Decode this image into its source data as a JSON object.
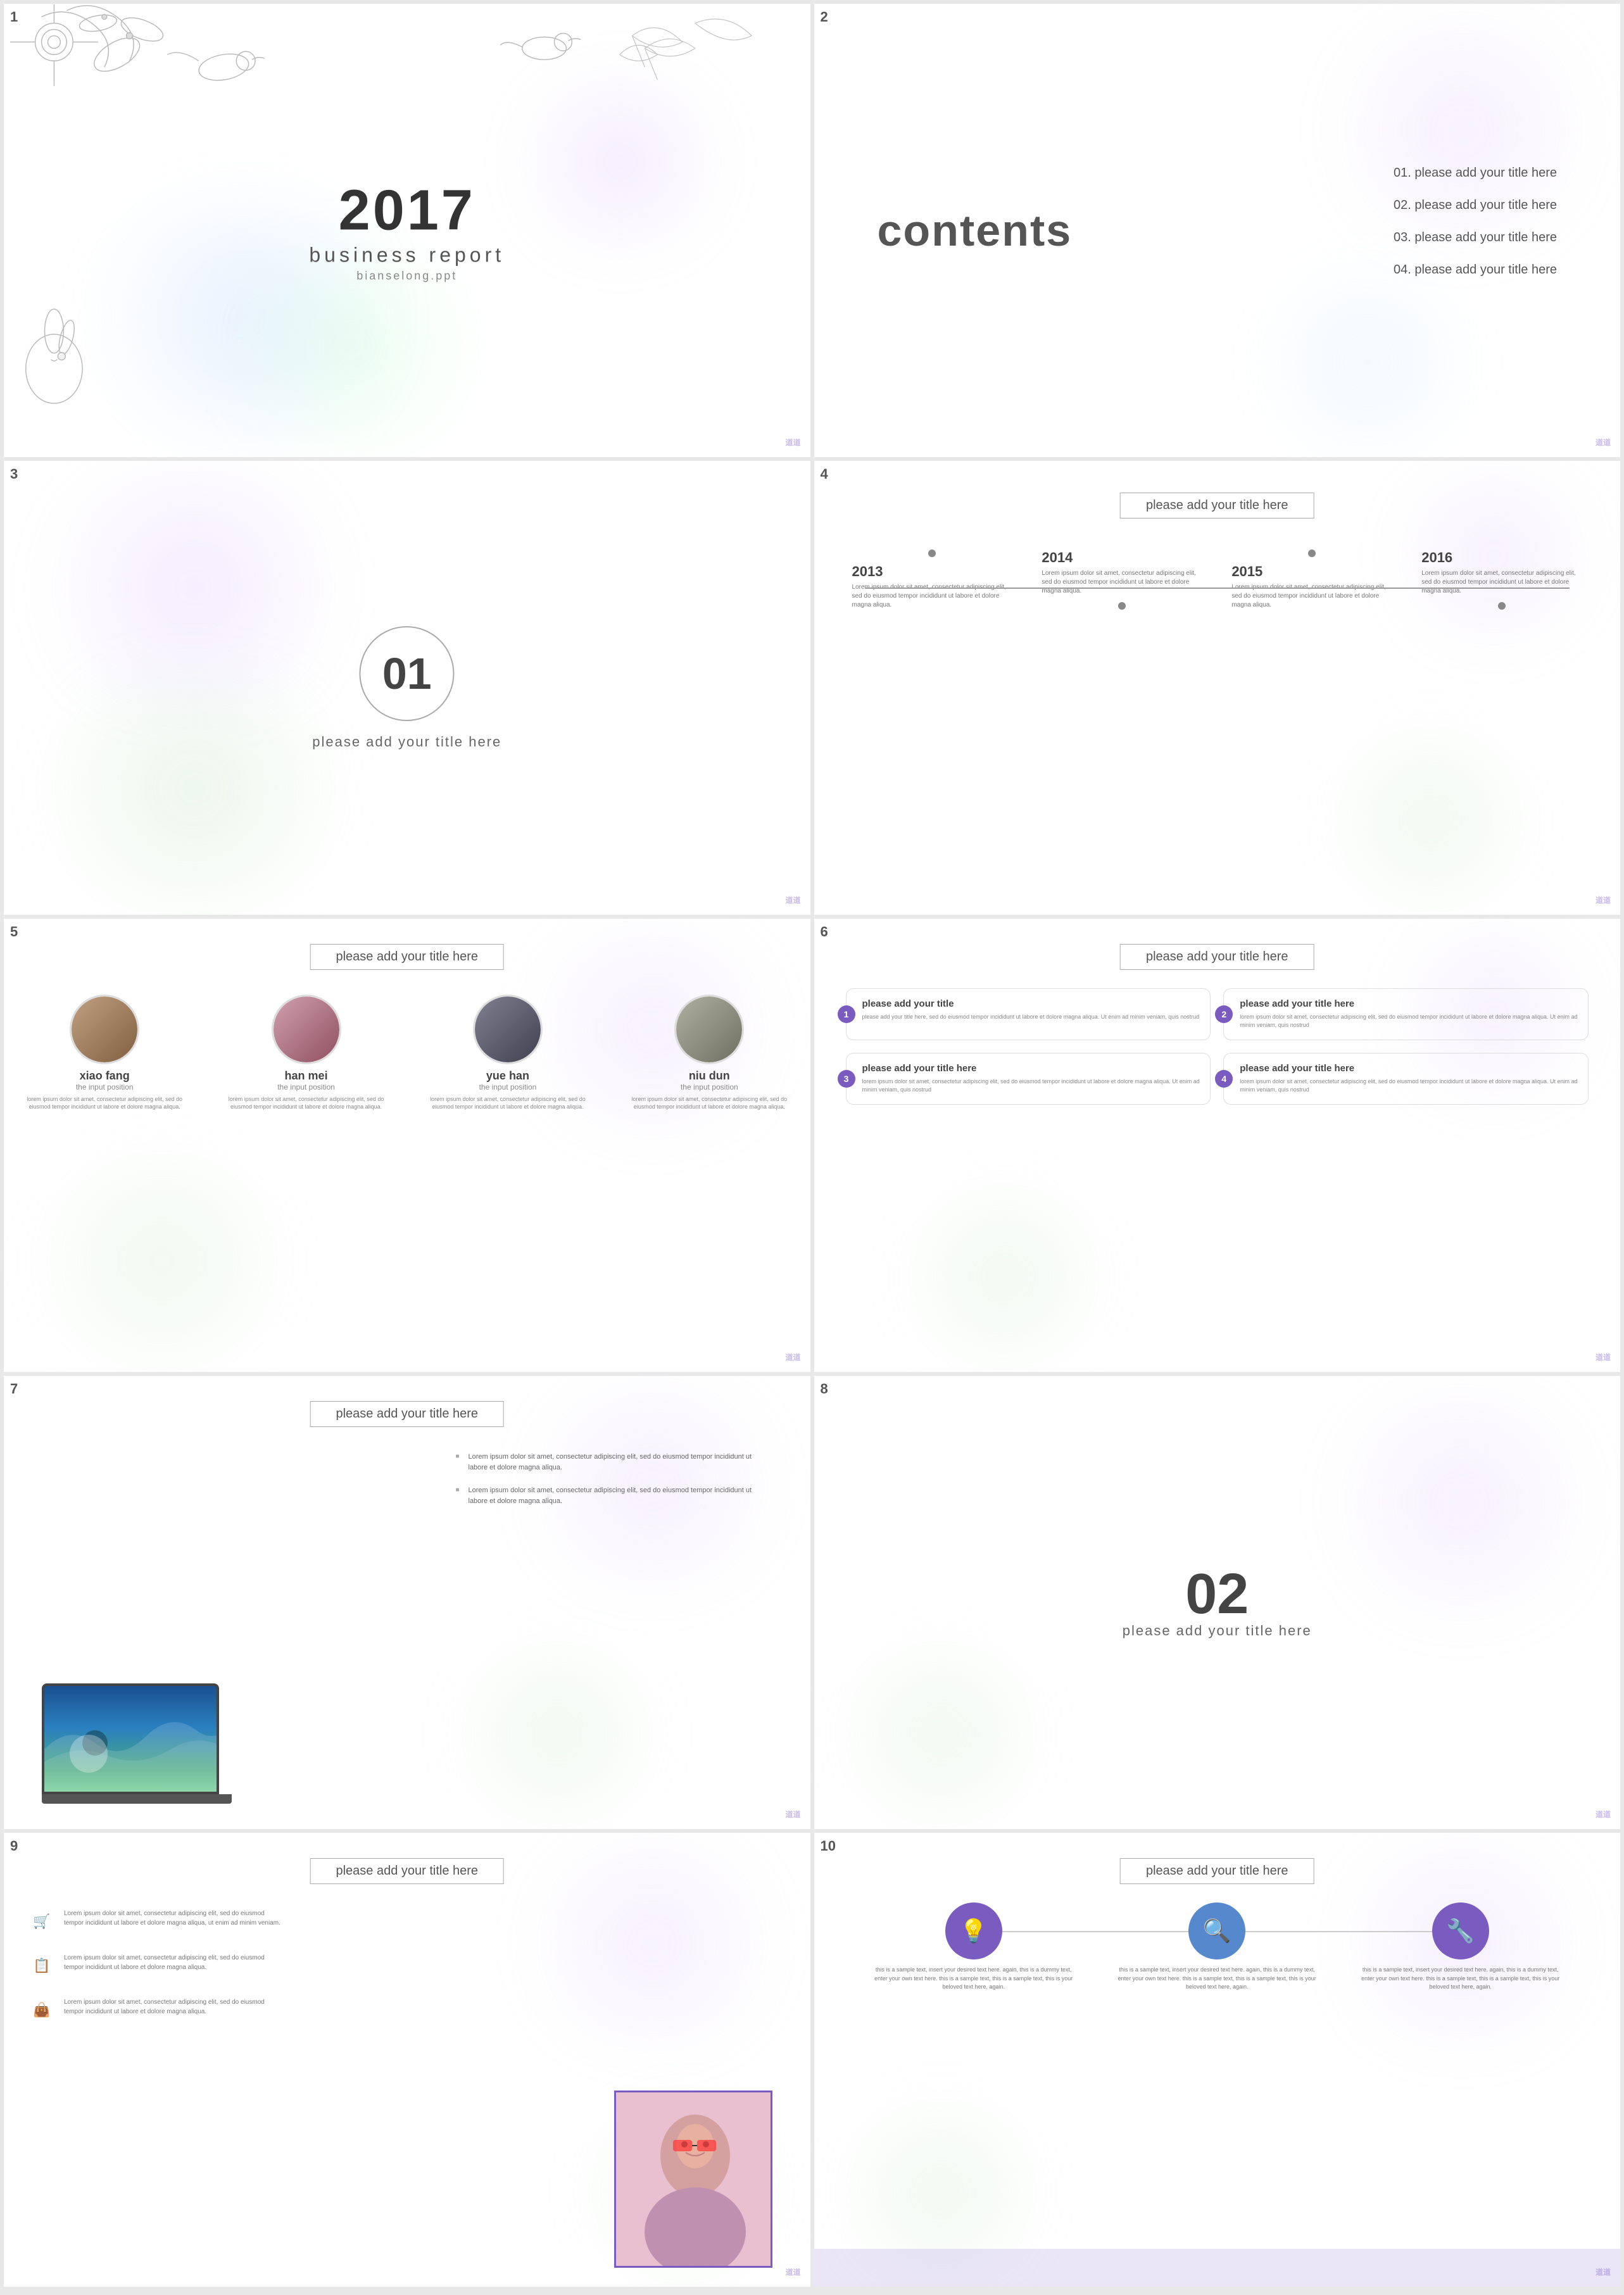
{
  "slides": [
    {
      "number": "1",
      "year": "2017",
      "title": "business report",
      "subtitle": "bianselong.ppt"
    },
    {
      "number": "2",
      "heading": "contents",
      "items": [
        "01. please add your title here",
        "02. please add your title here",
        "03. please add your title here",
        "04. please add your title here"
      ]
    },
    {
      "number": "3",
      "chapter": "01",
      "subtitle": "please add your title here"
    },
    {
      "number": "4",
      "title": "please add your title here",
      "timeline": [
        {
          "year": "2013",
          "text": "Lorem ipsum dolor sit amet, consectetur adipiscing elit, sed do eiusmod tempor incididunt ut labore et dolore magna aliqua."
        },
        {
          "year": "2014",
          "text": "Lorem ipsum dolor sit amet, consectetur adipiscing elit, sed do eiusmod tempor incididunt ut labore et dolore magna aliqua."
        },
        {
          "year": "2015",
          "text": "Lorem ipsum dolor sit amet, consectetur adipiscing elit, sed do eiusmod tempor incididunt ut labore et dolore magna aliqua."
        },
        {
          "year": "2016",
          "text": "Lorem ipsum dolor sit amet, consectetur adipiscing elit, sed do eiusmod tempor incididunt ut labore et dolore magna aliqua."
        }
      ]
    },
    {
      "number": "5",
      "title": "please add your title here",
      "persons": [
        {
          "name": "xiao fang",
          "role": "the input position",
          "desc": "lorem ipsum dolor sit amet, consectetur adipiscing elit, sed do eiusmod tempor incididunt ut labore et dolore magna aliqua."
        },
        {
          "name": "han mei",
          "role": "the input position",
          "desc": "lorem ipsum dolor sit amet, consectetur adipiscing elit, sed do eiusmod tempor incididunt ut labore et dolore magna aliqua."
        },
        {
          "name": "yue han",
          "role": "the input position",
          "desc": "lorem ipsum dolor sit amet, consectetur adipiscing elit, sed do eiusmod tempor incididunt ut labore et dolore magna aliqua."
        },
        {
          "name": "niu dun",
          "role": "the input position",
          "desc": "lorem ipsum dolor sit amet, consectetur adipiscing elit, sed do eiusmod tempor incididunt ut labore et dolore magna aliqua."
        }
      ]
    },
    {
      "number": "6",
      "title": "please add your title here",
      "cards": [
        {
          "num": "1",
          "title": "please add your title",
          "text": "please add your title here, sed do eiusmod tempor incididunt ut labore et dolore magna aliqua. Ut enim ad minim veniam, quis nostrud"
        },
        {
          "num": "2",
          "title": "please add your title here",
          "text": "lorem ipsum dolor sit amet, consectetur adipiscing elit, sed do eiusmod tempor incididunt ut labore et dolore magna aliqua. Ut enim ad minim veniam, quis nostrud"
        },
        {
          "num": "3",
          "title": "please add your title here",
          "text": "lorem ipsum dolor sit amet, consectetur adipiscing elit, sed do eiusmod tempor incididunt ut labore et dolore magna aliqua. Ut enim ad minim veniam, quis nostrud"
        },
        {
          "num": "4",
          "title": "please add your title here",
          "text": "lorem ipsum dolor sit amet, consectetur adipiscing elit, sed do eiusmod tempor incididunt ut labore et dolore magna aliqua. Ut enim ad minim veniam, quis nostrud"
        }
      ]
    },
    {
      "number": "7",
      "title": "please add your title here",
      "bullets": [
        "Lorem ipsum dolor sit amet, consectetur adipiscing elit, sed do eiusmod tempor incididunt ut labore et dolore magna aliqua.",
        "Lorem ipsum dolor sit amet, consectetur adipiscing elit, sed do eiusmod tempor incididunt ut labore et dolore magna aliqua."
      ]
    },
    {
      "number": "8",
      "chapter": "02",
      "subtitle": "please add your title here"
    },
    {
      "number": "9",
      "title": "please add your title here",
      "items": [
        {
          "icon": "🛒",
          "text": "Lorem ipsum dolor sit amet, consectetur adipiscing elit, sed do eiusmod tempor incididunt ut labore et dolore magna aliqua, ut enim ad minim veniam."
        },
        {
          "icon": "📋",
          "text": "Lorem ipsum dolor sit amet, consectetur adipiscing elit, sed do eiusmod tempor incididunt ut labore et dolore magna aliqua."
        },
        {
          "icon": "👜",
          "text": "Lorem ipsum dolor sit amet, consectetur adipiscing elit, sed do eiusmod tempor incididunt ut labore et dolore magna aliqua."
        }
      ]
    },
    {
      "number": "10",
      "title": "please add your title here",
      "icons": [
        {
          "symbol": "💡",
          "label": "this is a sample text, insert your desired text here. again, this is a dummy text, enter your own text here. this is a sample text, this is a sample text, this is your beloved text here, again."
        },
        {
          "symbol": "🔍",
          "label": "this is a sample text, insert your desired text here. again, this is a dummy text, enter your own text here. this is a sample text, this is a sample text, this is your beloved text here, again."
        },
        {
          "symbol": "🔧",
          "label": "this is a sample text, insert your desired text here. again, this is a dummy text, enter your own text here. this is a sample text, this is a sample text, this is your beloved text here, again."
        }
      ]
    }
  ],
  "watermark": "道道",
  "accent_color": "#7a5cc0"
}
